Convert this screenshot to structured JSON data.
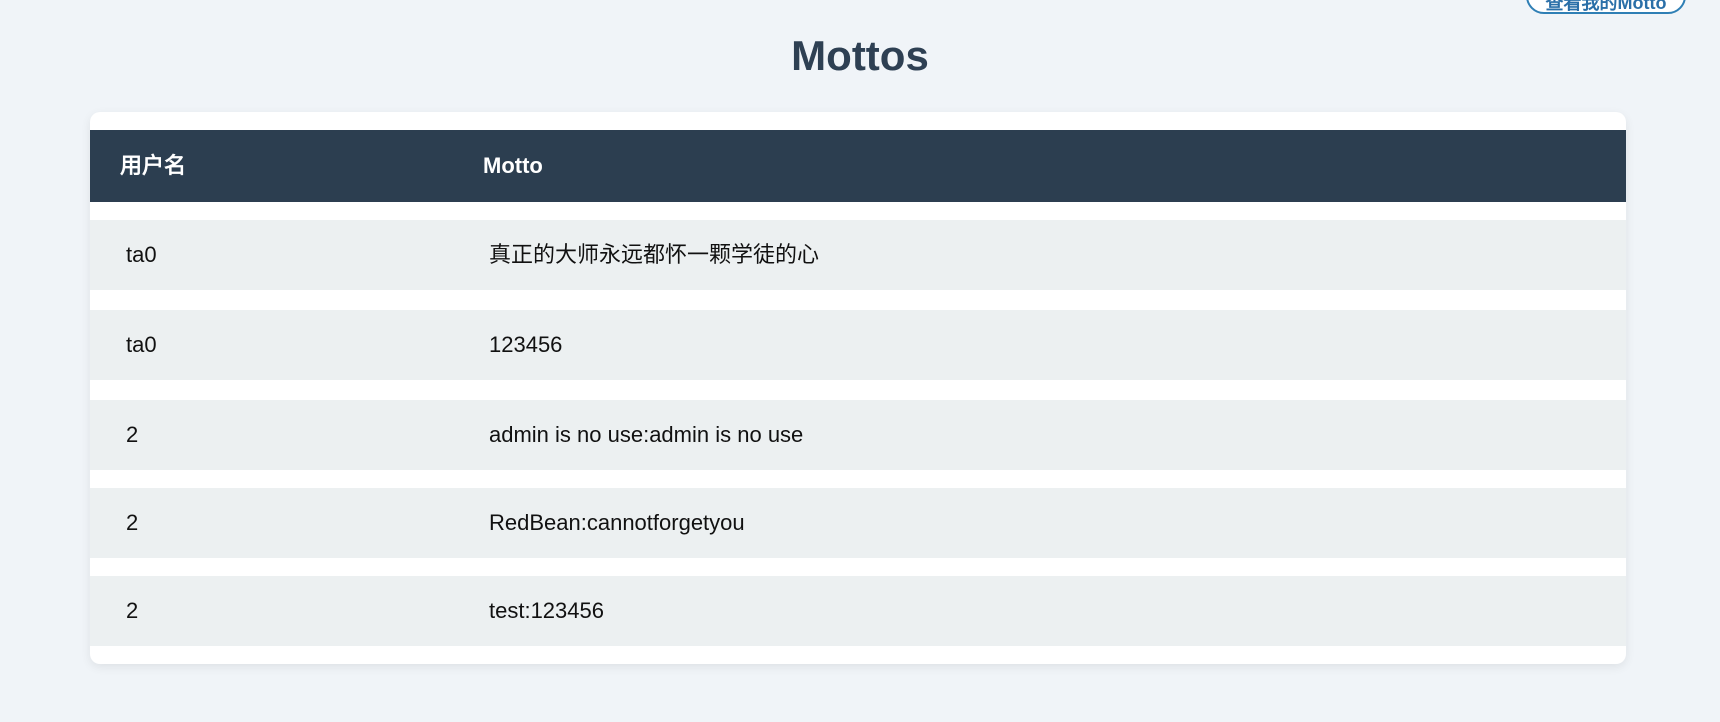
{
  "header": {
    "top_button_label": "查看我的Motto",
    "title": "Mottos"
  },
  "table": {
    "columns": [
      "用户名",
      "Motto"
    ],
    "rows": [
      {
        "username": "ta0",
        "motto": "真正的大师永远都怀一颗学徒的心"
      },
      {
        "username": "ta0",
        "motto": "123456"
      },
      {
        "username": "2",
        "motto": "admin is no use:admin is no use"
      },
      {
        "username": "2",
        "motto": "RedBean:cannotforgetyou"
      },
      {
        "username": "2",
        "motto": "test:123456"
      }
    ]
  },
  "colors": {
    "background": "#f0f4f8",
    "header_bg": "#2c3e50",
    "row_bg": "#ecf0f1",
    "title": "#2e4053",
    "accent": "#2f7fb5"
  }
}
